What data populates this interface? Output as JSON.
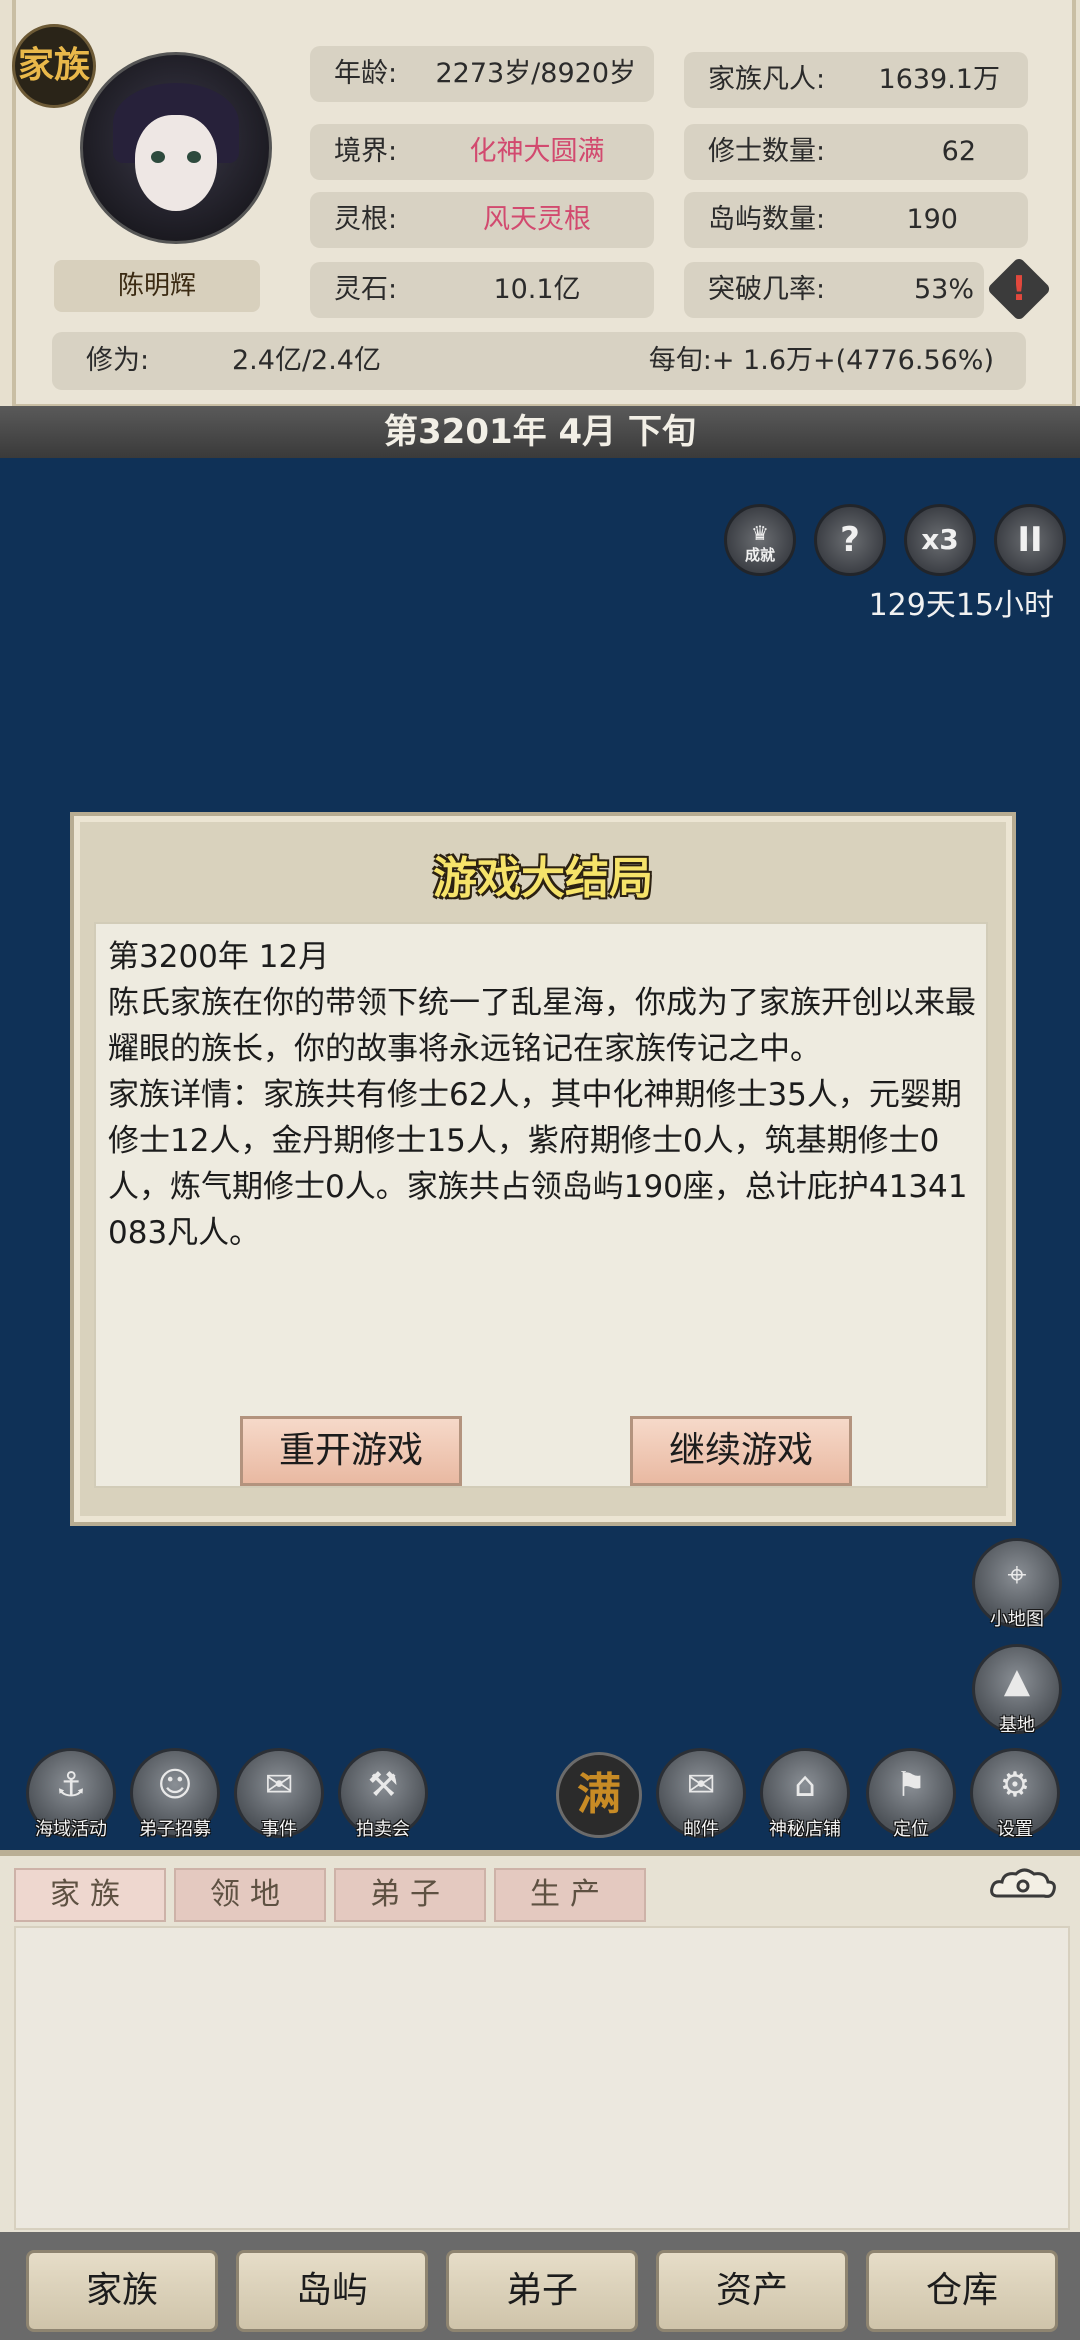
{
  "header": {
    "family_badge": "家族",
    "character_name": "陈明辉",
    "stats_left": [
      {
        "label": "年龄:",
        "value": "2273岁/8920岁",
        "highlight": false
      },
      {
        "label": "境界:",
        "value": "化神大圆满",
        "highlight": true
      },
      {
        "label": "灵根:",
        "value": "风天灵根",
        "highlight": true
      },
      {
        "label": "灵石:",
        "value": "10.1亿",
        "highlight": false
      }
    ],
    "stats_right": [
      {
        "label": "家族凡人:",
        "value": "1639.1万"
      },
      {
        "label": "修士数量:",
        "value": "62"
      },
      {
        "label": "岛屿数量:",
        "value": "190"
      },
      {
        "label": "突破几率:",
        "value": "53%"
      }
    ],
    "cultivation_label": "修为:",
    "cultivation_value": "2.4亿/2.4亿",
    "per_period": "每旬:+ 1.6万+(4776.56%)",
    "date": "第3201年 4月 下旬"
  },
  "controls": {
    "achievement_label": "成就",
    "help_glyph": "?",
    "speed_label": "x3",
    "pause_glyph": "II",
    "timer": "129天15小时"
  },
  "dialog": {
    "title": "游戏大结局",
    "lines": [
      "第3200年 12月",
      "陈氏家族在你的带领下统一了乱星海，你成为了家族开创以来最耀眼的族长，你的故事将永远铭记在家族传记之中。",
      "家族详情：家族共有修士62人，其中化神期修士35人，元婴期修士12人，金丹期修士15人，紫府期修士0人，筑基期修士0人，炼气期修士0人。家族共占领岛屿190座，总计庇护41341083凡人。"
    ],
    "restart_label": "重开游戏",
    "continue_label": "继续游戏"
  },
  "side_actions": {
    "minimap": "小地图",
    "base": "基地"
  },
  "action_bar": {
    "left": [
      "海域活动",
      "弟子招募",
      "事件",
      "拍卖会"
    ],
    "man_glyph": "满",
    "right": [
      "邮件",
      "神秘店铺",
      "定位",
      "设置"
    ]
  },
  "lower_tabs": [
    "家族",
    "领地",
    "弟子",
    "生产"
  ],
  "bottom_nav": [
    "家族",
    "岛屿",
    "弟子",
    "资产",
    "仓库"
  ],
  "colors": {
    "sea": "#0f3157",
    "panel": "#e7e0cf",
    "highlight_text": "#d24a6f",
    "title_yellow": "#f6e36a"
  }
}
